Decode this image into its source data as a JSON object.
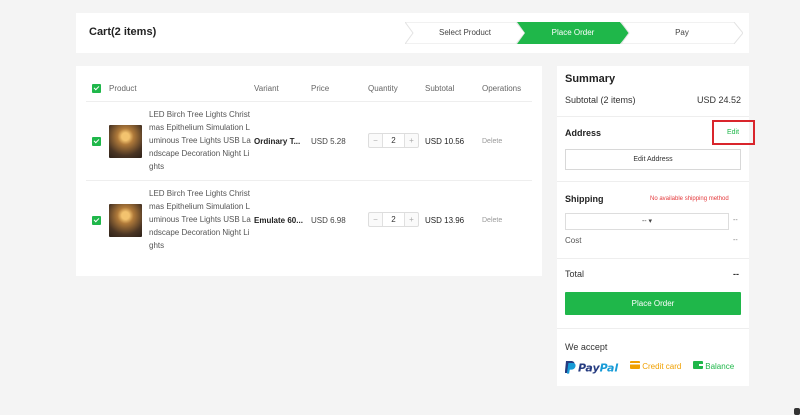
{
  "header": {
    "cart_title": "Cart(2 items)",
    "steps": [
      {
        "label": "Select Product",
        "active": false
      },
      {
        "label": "Place Order",
        "active": true
      },
      {
        "label": "Pay",
        "active": false
      }
    ]
  },
  "cart": {
    "columns": {
      "product": "Product",
      "variant": "Variant",
      "price": "Price",
      "quantity": "Quantity",
      "subtotal": "Subtotal",
      "operations": "Operations"
    },
    "items": [
      {
        "name": "LED Birch Tree Lights Christmas Epithelium Simulation Luminous Tree Lights USB Landscape Decoration Night Lights",
        "variant": "Ordinary T...",
        "price": "USD 5.28",
        "minus": "−",
        "quantity": "2",
        "plus": "+",
        "subtotal": "USD 10.56",
        "delete": "Delete",
        "checked": true
      },
      {
        "name": "LED Birch Tree Lights Christmas Epithelium Simulation Luminous Tree Lights USB Landscape Decoration Night Lights",
        "variant": "Emulate 60...",
        "price": "USD 6.98",
        "minus": "−",
        "quantity": "2",
        "plus": "+",
        "subtotal": "USD 13.96",
        "delete": "Delete",
        "checked": true
      }
    ]
  },
  "summary": {
    "title": "Summary",
    "subtotal_label": "Subtotal (2 items)",
    "subtotal_value": "USD 24.52",
    "address_title": "Address",
    "edit_label": "Edit",
    "edit_address_button": "Edit Address",
    "shipping_title": "Shipping",
    "no_shipping": "No available shipping method",
    "shipping_select": "-- ▾",
    "shipping_dash": "--",
    "cost_label": "Cost",
    "cost_value": "--",
    "total_label": "Total",
    "total_value": "--",
    "place_order_button": "Place Order",
    "we_accept": "We accept",
    "paypal": "PayPal",
    "credit_card": "Credit card",
    "balance": "Balance"
  },
  "colors": {
    "accent": "#1fb74a",
    "highlight_box": "#d9252c",
    "warning": "#e4393c",
    "paypal_dark": "#253b80",
    "paypal_light": "#179bd7"
  }
}
